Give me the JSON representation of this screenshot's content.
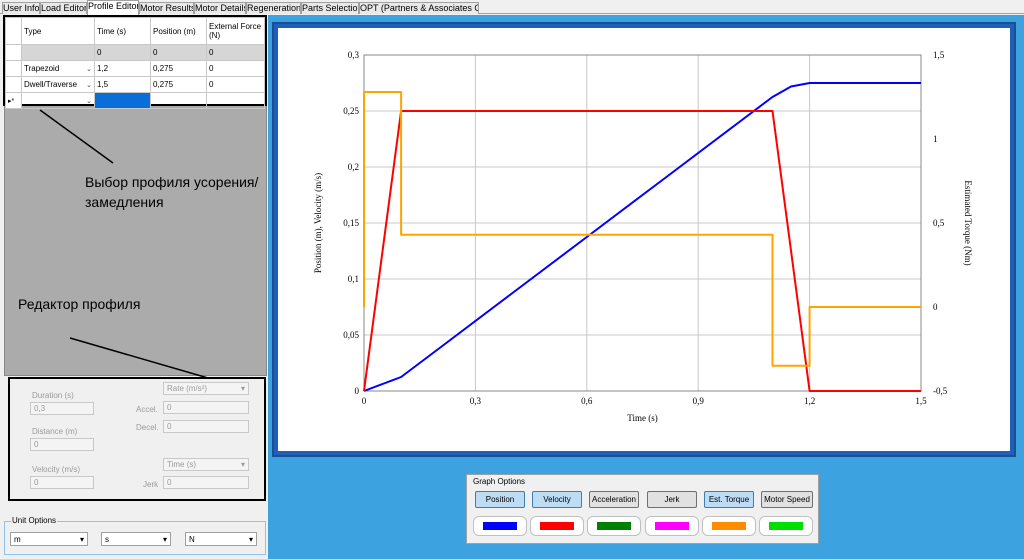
{
  "tabs": [
    {
      "label": "User Info"
    },
    {
      "label": "Load Editor"
    },
    {
      "label": "Profile Editor",
      "active": true
    },
    {
      "label": "Motor Results"
    },
    {
      "label": "Motor Details"
    },
    {
      "label": "Regeneration"
    },
    {
      "label": "Parts Selection"
    },
    {
      "label": "OPT (Partners & Associates Only)"
    }
  ],
  "grid": {
    "headers": [
      "Type",
      "Time (s)",
      "Position (m)",
      "External Force (N)"
    ],
    "rows": [
      {
        "type": "",
        "time": "0",
        "position": "0",
        "force": "0"
      },
      {
        "type": "Trapezoid",
        "time": "1,2",
        "position": "0,275",
        "force": "0"
      },
      {
        "type": "Dwell/Traverse",
        "time": "1,5",
        "position": "0,275",
        "force": "0"
      }
    ],
    "new_row_marker": "▸*"
  },
  "annotations": {
    "profile_select": "Выбор профиля усорения/замедления",
    "profile_editor": "Редактор профиля"
  },
  "editor": {
    "duration_label": "Duration (s)",
    "duration_value": "0,3",
    "distance_label": "Distance (m)",
    "distance_value": "0",
    "velocity_label": "Velocity (m/s)",
    "velocity_value": "0",
    "rate_select": "Rate (m/s²)",
    "accel_label": "Accel.",
    "accel_value": "0",
    "decel_label": "Decel.",
    "decel_value": "0",
    "time_select": "Time (s)",
    "jerk_label": "Jerk",
    "jerk_value": "0"
  },
  "unit_options": {
    "legend": "Unit Options",
    "distance": "m",
    "time": "s",
    "force": "N"
  },
  "graph_options": {
    "title": "Graph Options",
    "buttons": [
      {
        "label": "Position",
        "color": "#0000ff",
        "on": true
      },
      {
        "label": "Velocity",
        "color": "#ff0000",
        "on": true
      },
      {
        "label": "Acceleration",
        "color": "#008000",
        "on": false
      },
      {
        "label": "Jerk",
        "color": "#ff00ff",
        "on": false
      },
      {
        "label": "Est. Torque",
        "color": "#ff8c00",
        "on": true
      },
      {
        "label": "Motor Speed",
        "color": "#00e000",
        "on": false
      }
    ]
  },
  "chart_data": {
    "type": "line",
    "xlabel": "Time (s)",
    "ylabel": "Position (m), Velocity (m/s)",
    "y2label": "Estimated Torque (Nm)",
    "xlim": [
      0,
      1.5
    ],
    "ylim": [
      0,
      0.3
    ],
    "y2lim": [
      -0.5,
      1.5
    ],
    "x_ticks": [
      "0",
      "0,3",
      "0,6",
      "0,9",
      "1,2",
      "1,5"
    ],
    "y_ticks": [
      "0",
      "0,05",
      "0,1",
      "0,15",
      "0,2",
      "0,25",
      "0,3"
    ],
    "y2_ticks": [
      "-0,5",
      "0",
      "0,5",
      "1",
      "1,5"
    ],
    "grid": true,
    "series": [
      {
        "name": "Position",
        "color": "#0000ff",
        "axis": "left",
        "x": [
          0,
          0.05,
          0.1,
          0.2,
          0.4,
          0.6,
          0.8,
          1.0,
          1.1,
          1.15,
          1.2,
          1.5
        ],
        "y": [
          0,
          0.00625,
          0.0125,
          0.0375,
          0.0875,
          0.1375,
          0.1875,
          0.2375,
          0.2625,
          0.2719,
          0.275,
          0.275
        ]
      },
      {
        "name": "Velocity",
        "color": "#ff0000",
        "axis": "left",
        "x": [
          0,
          0.1,
          1.1,
          1.2,
          1.5
        ],
        "y": [
          0,
          0.25,
          0.25,
          0,
          0
        ]
      },
      {
        "name": "Est. Torque",
        "color": "#ffa500",
        "axis": "right",
        "x": [
          0,
          0.0,
          0.1,
          0.1,
          1.1,
          1.1,
          1.2,
          1.2,
          1.5
        ],
        "y": [
          0,
          1.28,
          1.28,
          0.43,
          0.43,
          -0.35,
          -0.35,
          0,
          0
        ]
      }
    ]
  }
}
